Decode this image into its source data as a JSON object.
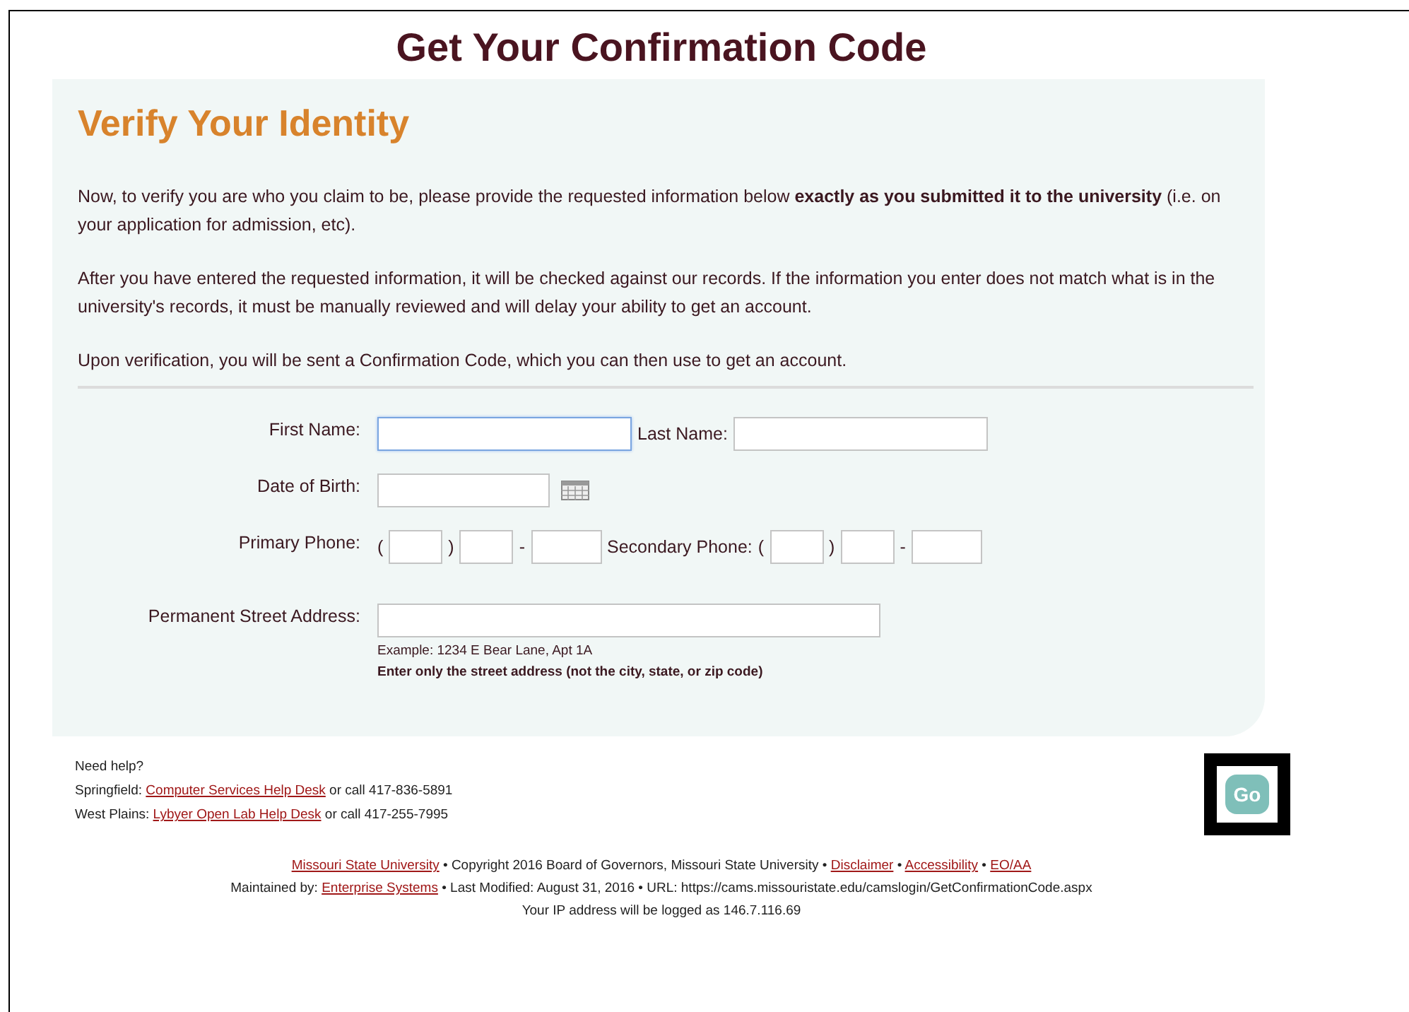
{
  "title": "Get Your Confirmation Code",
  "panel": {
    "heading": "Verify Your Identity",
    "paragraphs": [
      "Now, to verify you are who you claim to be, please provide the requested information below **exactly as you submitted it to the university** (i.e. on your application for admission, etc).",
      "After you have entered the requested information, it will be checked against our records. If the information you enter does not match what is in the university's records, it must be manually reviewed and will delay your ability to get an account.",
      "Upon verification, you will be sent a Confirmation Code, which you can then use to get an account."
    ],
    "rows": [
      {
        "label": "First Name:",
        "items": [
          {
            "kind": "name",
            "focused": true
          },
          {
            "kind": "label",
            "text": "Last Name:"
          },
          {
            "kind": "name",
            "focused": false
          }
        ]
      },
      {
        "label": "Date of Birth:",
        "items": [
          {
            "kind": "date",
            "focused": false
          },
          {
            "kind": "calendar"
          }
        ]
      },
      {
        "label": "Primary Phone:",
        "items": [
          {
            "kind": "punct",
            "text": "("
          },
          {
            "kind": "areacode",
            "focused": false
          },
          {
            "kind": "punct",
            "text": ")"
          },
          {
            "kind": "prefix",
            "focused": false
          },
          {
            "kind": "punct",
            "text": "-"
          },
          {
            "kind": "number",
            "focused": false
          },
          {
            "kind": "label",
            "text": "Secondary Phone:"
          },
          {
            "kind": "punct",
            "text": "("
          },
          {
            "kind": "areacode",
            "focused": false
          },
          {
            "kind": "punct",
            "text": ")"
          },
          {
            "kind": "prefix",
            "focused": false
          },
          {
            "kind": "punct",
            "text": "-"
          },
          {
            "kind": "number",
            "focused": false
          }
        ]
      },
      {
        "label": "Permanent Street Address:",
        "items": [
          {
            "kind": "address",
            "focused": false
          }
        ],
        "hints": [
          {
            "text": "Example: 1234 E Bear Lane, Apt 1A",
            "bold": false
          },
          {
            "text": "Enter only the street address (not the city, state, or zip code)",
            "bold": true
          }
        ]
      }
    ]
  },
  "help": {
    "heading": "Need help?",
    "lines": [
      [
        {
          "text": "Springfield: ",
          "link": false
        },
        {
          "text": "Computer Services Help Desk",
          "link": true
        },
        {
          "text": " or call 417-836-5891",
          "link": false
        }
      ],
      [
        {
          "text": "West Plains: ",
          "link": false
        },
        {
          "text": "Lybyer Open Lab Help Desk",
          "link": true
        },
        {
          "text": " or call 417-255-7995",
          "link": false
        }
      ]
    ]
  },
  "go_button": "Go",
  "footer": [
    [
      {
        "text": "Missouri State University",
        "link": true
      },
      {
        "text": " • Copyright 2016 Board of Governors, Missouri State University • ",
        "link": false
      },
      {
        "text": "Disclaimer",
        "link": true
      },
      {
        "text": " • ",
        "link": false
      },
      {
        "text": "Accessibility",
        "link": true
      },
      {
        "text": " • ",
        "link": false
      },
      {
        "text": "EO/AA",
        "link": true
      }
    ],
    [
      {
        "text": "Maintained by: ",
        "link": false
      },
      {
        "text": "Enterprise Systems",
        "link": true
      },
      {
        "text": " • Last Modified: August 31, 2016 • URL: https://cams.missouristate.edu/camslogin/GetConfirmationCode.aspx",
        "link": false
      }
    ],
    [
      {
        "text": "Your IP address will be logged as 146.7.116.69",
        "link": false
      }
    ]
  ]
}
